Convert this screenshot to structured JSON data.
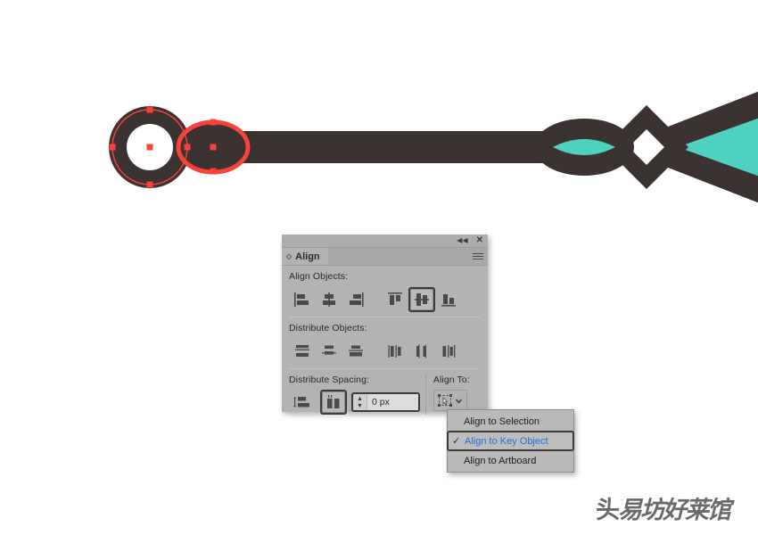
{
  "app": {
    "canvas_bg": "#ffffff",
    "artwork_dark": "#3a3331",
    "artwork_teal": "#4fd1c0",
    "selection_red": "#f9423a"
  },
  "panel": {
    "title_tab": "Align",
    "tab_icon": "diamond-toggle-icon",
    "collapse_icon": "collapse-double-left-icon",
    "close_icon": "close-icon",
    "menu_icon": "panel-menu-icon",
    "sections": {
      "align_objects": {
        "label": "Align Objects:",
        "buttons": [
          {
            "name": "horizontal-align-left",
            "selected": false
          },
          {
            "name": "horizontal-align-center",
            "selected": false
          },
          {
            "name": "horizontal-align-right",
            "selected": false
          },
          {
            "name": "vertical-align-top",
            "selected": false
          },
          {
            "name": "vertical-align-center",
            "selected": true
          },
          {
            "name": "vertical-align-bottom",
            "selected": false
          }
        ]
      },
      "distribute_objects": {
        "label": "Distribute Objects:",
        "buttons": [
          {
            "name": "vertical-distribute-top",
            "selected": false
          },
          {
            "name": "vertical-distribute-center",
            "selected": false
          },
          {
            "name": "vertical-distribute-bottom",
            "selected": false
          },
          {
            "name": "horizontal-distribute-left",
            "selected": false
          },
          {
            "name": "horizontal-distribute-center",
            "selected": false
          },
          {
            "name": "horizontal-distribute-right",
            "selected": false
          }
        ]
      },
      "distribute_spacing": {
        "label": "Distribute Spacing:",
        "buttons": [
          {
            "name": "vertical-distribute-space",
            "selected": false
          },
          {
            "name": "horizontal-distribute-space",
            "selected": true
          }
        ],
        "value": "0 px",
        "placeholder": "0 px"
      },
      "align_to": {
        "label": "Align To:",
        "button_icon": "align-to-key-object-icon",
        "chevron": "chevron-down-icon"
      }
    }
  },
  "dropdown": {
    "items": [
      {
        "label": "Align to Selection",
        "checked": false
      },
      {
        "label": "Align to Key Object",
        "checked": true
      },
      {
        "label": "Align to Artboard",
        "checked": false
      }
    ],
    "check_glyph": "✓",
    "highlight_color": "#1f6fd8"
  },
  "watermark": {
    "text_a": "头",
    "text_b": "易坊好莱馆"
  }
}
